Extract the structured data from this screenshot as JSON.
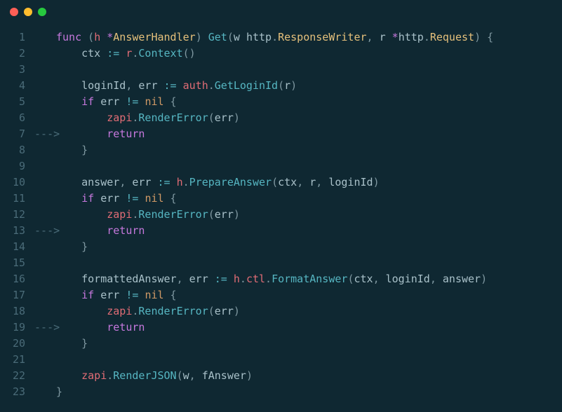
{
  "titlebar": {
    "dots": [
      "red",
      "yellow",
      "green"
    ]
  },
  "editor": {
    "lines": [
      {
        "n": "1",
        "arrow": "",
        "tokens": [
          [
            "kw",
            "func"
          ],
          [
            "punct",
            " ("
          ],
          [
            "field",
            "h"
          ],
          [
            "punct",
            " "
          ],
          [
            "star",
            "*"
          ],
          [
            "type",
            "AnswerHandler"
          ],
          [
            "punct",
            ") "
          ],
          [
            "call",
            "Get"
          ],
          [
            "punct",
            "("
          ],
          [
            "ident",
            "w"
          ],
          [
            "punct",
            " "
          ],
          [
            "ident",
            "http"
          ],
          [
            "punct",
            "."
          ],
          [
            "type",
            "ResponseWriter"
          ],
          [
            "punct",
            ", "
          ],
          [
            "ident",
            "r"
          ],
          [
            "punct",
            " "
          ],
          [
            "star",
            "*"
          ],
          [
            "ident",
            "http"
          ],
          [
            "punct",
            "."
          ],
          [
            "type",
            "Request"
          ],
          [
            "punct",
            ") {"
          ]
        ]
      },
      {
        "n": "2",
        "arrow": "",
        "tokens": [
          [
            "ident",
            "ctx"
          ],
          [
            "punct",
            " "
          ],
          [
            "op",
            ":="
          ],
          [
            "punct",
            " "
          ],
          [
            "field",
            "r"
          ],
          [
            "punct",
            "."
          ],
          [
            "call",
            "Context"
          ],
          [
            "punct",
            "()"
          ]
        ]
      },
      {
        "n": "3",
        "arrow": "",
        "tokens": []
      },
      {
        "n": "4",
        "arrow": "",
        "tokens": [
          [
            "ident",
            "loginId"
          ],
          [
            "punct",
            ", "
          ],
          [
            "ident",
            "err"
          ],
          [
            "punct",
            " "
          ],
          [
            "op",
            ":="
          ],
          [
            "punct",
            " "
          ],
          [
            "field",
            "auth"
          ],
          [
            "punct",
            "."
          ],
          [
            "call",
            "GetLoginId"
          ],
          [
            "punct",
            "("
          ],
          [
            "ident",
            "r"
          ],
          [
            "punct",
            ")"
          ]
        ]
      },
      {
        "n": "5",
        "arrow": "",
        "tokens": [
          [
            "kw",
            "if"
          ],
          [
            "punct",
            " "
          ],
          [
            "ident",
            "err"
          ],
          [
            "punct",
            " "
          ],
          [
            "op",
            "!="
          ],
          [
            "punct",
            " "
          ],
          [
            "builtin",
            "nil"
          ],
          [
            "punct",
            " {"
          ]
        ]
      },
      {
        "n": "6",
        "arrow": "",
        "tokens": [
          [
            "ident",
            "    "
          ],
          [
            "field",
            "zapi"
          ],
          [
            "punct",
            "."
          ],
          [
            "call",
            "RenderError"
          ],
          [
            "punct",
            "("
          ],
          [
            "ident",
            "err"
          ],
          [
            "punct",
            ")"
          ]
        ]
      },
      {
        "n": "7",
        "arrow": "--->",
        "tokens": [
          [
            "ident",
            "    "
          ],
          [
            "kw",
            "return"
          ]
        ]
      },
      {
        "n": "8",
        "arrow": "",
        "tokens": [
          [
            "punct",
            "}"
          ]
        ]
      },
      {
        "n": "9",
        "arrow": "",
        "tokens": []
      },
      {
        "n": "10",
        "arrow": "",
        "tokens": [
          [
            "ident",
            "answer"
          ],
          [
            "punct",
            ", "
          ],
          [
            "ident",
            "err"
          ],
          [
            "punct",
            " "
          ],
          [
            "op",
            ":="
          ],
          [
            "punct",
            " "
          ],
          [
            "field",
            "h"
          ],
          [
            "punct",
            "."
          ],
          [
            "call",
            "PrepareAnswer"
          ],
          [
            "punct",
            "("
          ],
          [
            "ident",
            "ctx"
          ],
          [
            "punct",
            ", "
          ],
          [
            "ident",
            "r"
          ],
          [
            "punct",
            ", "
          ],
          [
            "ident",
            "loginId"
          ],
          [
            "punct",
            ")"
          ]
        ]
      },
      {
        "n": "11",
        "arrow": "",
        "tokens": [
          [
            "kw",
            "if"
          ],
          [
            "punct",
            " "
          ],
          [
            "ident",
            "err"
          ],
          [
            "punct",
            " "
          ],
          [
            "op",
            "!="
          ],
          [
            "punct",
            " "
          ],
          [
            "builtin",
            "nil"
          ],
          [
            "punct",
            " {"
          ]
        ]
      },
      {
        "n": "12",
        "arrow": "",
        "tokens": [
          [
            "ident",
            "    "
          ],
          [
            "field",
            "zapi"
          ],
          [
            "punct",
            "."
          ],
          [
            "call",
            "RenderError"
          ],
          [
            "punct",
            "("
          ],
          [
            "ident",
            "err"
          ],
          [
            "punct",
            ")"
          ]
        ]
      },
      {
        "n": "13",
        "arrow": "--->",
        "tokens": [
          [
            "ident",
            "    "
          ],
          [
            "kw",
            "return"
          ]
        ]
      },
      {
        "n": "14",
        "arrow": "",
        "tokens": [
          [
            "punct",
            "}"
          ]
        ]
      },
      {
        "n": "15",
        "arrow": "",
        "tokens": []
      },
      {
        "n": "16",
        "arrow": "",
        "tokens": [
          [
            "ident",
            "formattedAnswer"
          ],
          [
            "punct",
            ", "
          ],
          [
            "ident",
            "err"
          ],
          [
            "punct",
            " "
          ],
          [
            "op",
            ":="
          ],
          [
            "punct",
            " "
          ],
          [
            "field",
            "h"
          ],
          [
            "punct",
            "."
          ],
          [
            "field",
            "ctl"
          ],
          [
            "punct",
            "."
          ],
          [
            "call",
            "FormatAnswer"
          ],
          [
            "punct",
            "("
          ],
          [
            "ident",
            "ctx"
          ],
          [
            "punct",
            ", "
          ],
          [
            "ident",
            "loginId"
          ],
          [
            "punct",
            ", "
          ],
          [
            "ident",
            "answer"
          ],
          [
            "punct",
            ")"
          ]
        ]
      },
      {
        "n": "17",
        "arrow": "",
        "tokens": [
          [
            "kw",
            "if"
          ],
          [
            "punct",
            " "
          ],
          [
            "ident",
            "err"
          ],
          [
            "punct",
            " "
          ],
          [
            "op",
            "!="
          ],
          [
            "punct",
            " "
          ],
          [
            "builtin",
            "nil"
          ],
          [
            "punct",
            " {"
          ]
        ]
      },
      {
        "n": "18",
        "arrow": "",
        "tokens": [
          [
            "ident",
            "    "
          ],
          [
            "field",
            "zapi"
          ],
          [
            "punct",
            "."
          ],
          [
            "call",
            "RenderError"
          ],
          [
            "punct",
            "("
          ],
          [
            "ident",
            "err"
          ],
          [
            "punct",
            ")"
          ]
        ]
      },
      {
        "n": "19",
        "arrow": "--->",
        "tokens": [
          [
            "ident",
            "    "
          ],
          [
            "kw",
            "return"
          ]
        ]
      },
      {
        "n": "20",
        "arrow": "",
        "tokens": [
          [
            "punct",
            "}"
          ]
        ]
      },
      {
        "n": "21",
        "arrow": "",
        "tokens": []
      },
      {
        "n": "22",
        "arrow": "",
        "tokens": [
          [
            "field",
            "zapi"
          ],
          [
            "punct",
            "."
          ],
          [
            "call",
            "RenderJSON"
          ],
          [
            "punct",
            "("
          ],
          [
            "ident",
            "w"
          ],
          [
            "punct",
            ", "
          ],
          [
            "ident",
            "fAnswer"
          ],
          [
            "punct",
            ")"
          ]
        ]
      },
      {
        "n": "23",
        "arrow": "",
        "tokens": [
          [
            "punct",
            "}"
          ]
        ],
        "noindent": true
      }
    ],
    "base_indent": "    "
  }
}
